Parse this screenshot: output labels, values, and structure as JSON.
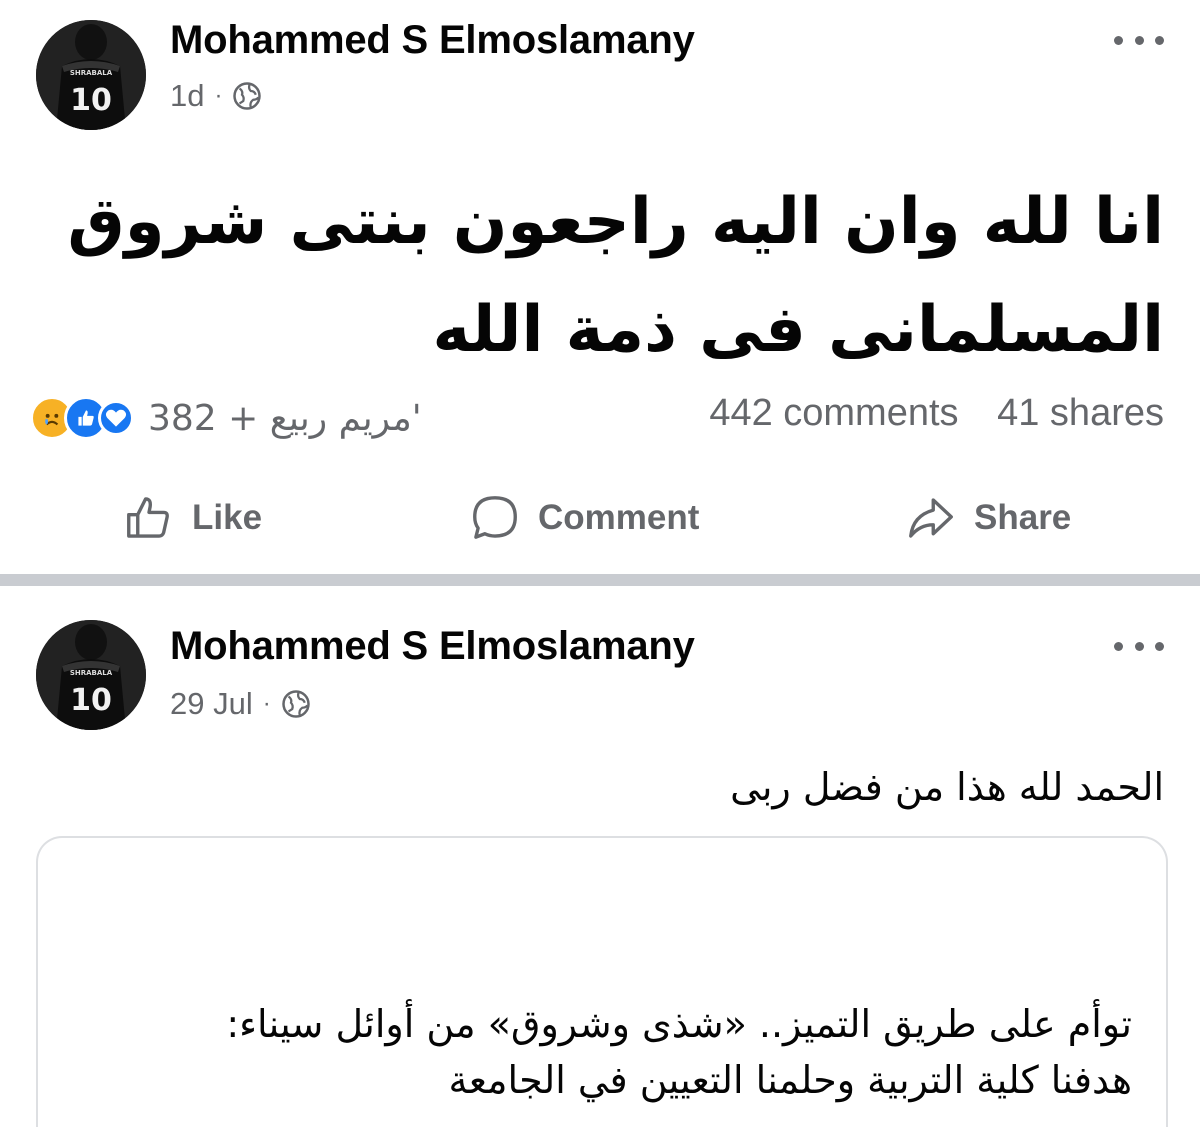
{
  "post1": {
    "author": "Mohammed S Elmoslamany",
    "time": "1d",
    "separator": "·",
    "body_line1": "انا لله وان اليه راجعون بنتى شروق",
    "body_line2": "المسلمانى فى ذمة الله",
    "reactions_text": "382 + مريم ربيع'",
    "reaction_icons": [
      "sad-reaction-icon",
      "like-reaction-icon",
      "love-reaction-icon"
    ],
    "comments": "442 comments",
    "shares": "41 shares",
    "actions": {
      "like": "Like",
      "comment": "Comment",
      "share": "Share"
    }
  },
  "post2": {
    "author": "Mohammed S Elmoslamany",
    "time": "29 Jul",
    "separator": "·",
    "caption": "الحمد لله هذا من فضل ربى",
    "card_line1": "توأم على طريق التميز.. «شذى وشروق» من أوائل سيناء:",
    "card_line2": "هدفنا كلية التربية وحلمنا التعيين في الجامعة"
  },
  "avatar": {
    "jersey_number": "10",
    "jersey_name": "SHRABALA"
  },
  "colors": {
    "text_primary": "#050505",
    "text_secondary": "#65676b",
    "divider": "#c9ccd1",
    "like_blue": "#1877f2",
    "sad_yellow": "#f7b125"
  }
}
